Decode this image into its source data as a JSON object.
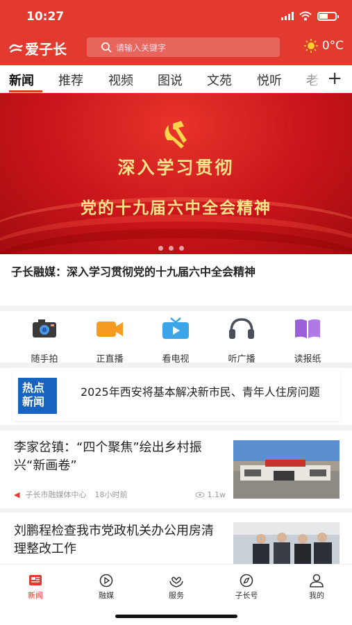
{
  "status_bar": {
    "time": "10:27"
  },
  "header": {
    "logo_text": "爱子长",
    "search_placeholder": "请输入关键字",
    "weather": "0°C"
  },
  "tabs": [
    "新闻",
    "推荐",
    "视频",
    "图说",
    "文苑",
    "悦听",
    "老"
  ],
  "banner": {
    "line1": "深入学习贯彻",
    "line2": "党的十九届六中全会精神",
    "caption": "子长融媒：深入学习贯彻党的十九届六中全会精神"
  },
  "quick_links": [
    {
      "label": "随手拍",
      "icon": "camera-icon"
    },
    {
      "label": "正直播",
      "icon": "live-camera-icon"
    },
    {
      "label": "看电视",
      "icon": "tv-icon"
    },
    {
      "label": "听广播",
      "icon": "headphones-icon"
    },
    {
      "label": "读报纸",
      "icon": "book-icon"
    }
  ],
  "hot_news": {
    "badge": "热点新闻",
    "text": "2025年西安将基本解决新市民、青年人住房问题"
  },
  "news": [
    {
      "title": "李家岔镇：“四个聚焦”绘出乡村振兴“新画卷”",
      "source": "子长市融媒体中心",
      "time": "18小时前",
      "views": "1.1w"
    },
    {
      "title": "刘鹏程检查我市党政机关办公用房清理整改工作"
    }
  ],
  "bottom_nav": [
    {
      "label": "新闻",
      "icon": "news-icon"
    },
    {
      "label": "融媒",
      "icon": "play-icon"
    },
    {
      "label": "服务",
      "icon": "heart-hands-icon"
    },
    {
      "label": "子长号",
      "icon": "compass-icon"
    },
    {
      "label": "我的",
      "icon": "user-icon"
    }
  ],
  "colors": {
    "brand": "#e23a2e",
    "banner_text": "#ffe38a",
    "hot_badge": "#1763c0"
  }
}
